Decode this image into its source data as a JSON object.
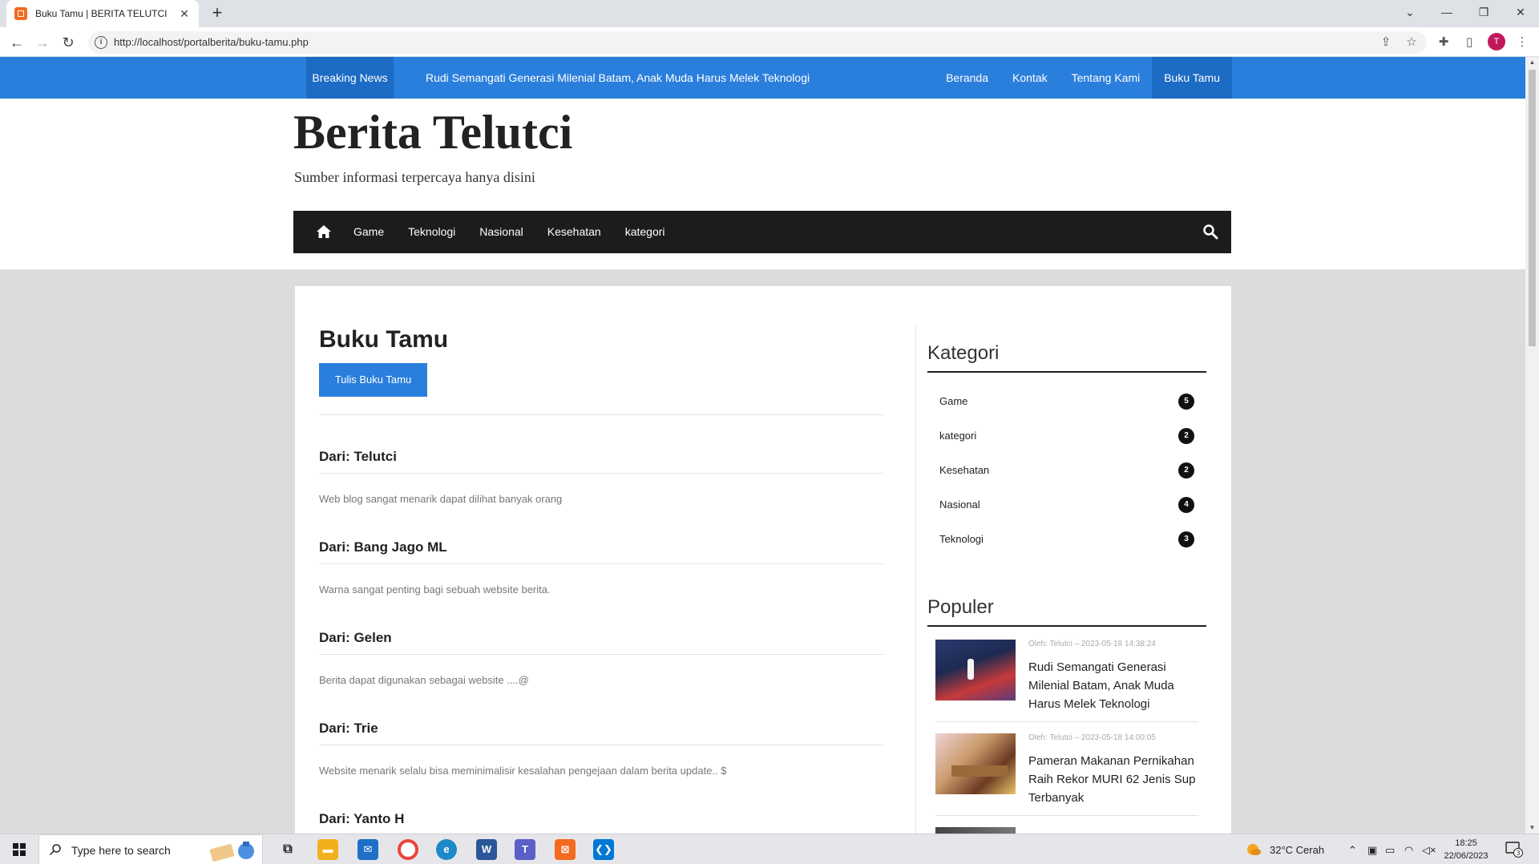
{
  "browser": {
    "tab_title": "Buku Tamu | BERITA TELUTCI",
    "url": "http://localhost/portalberita/buku-tamu.php",
    "profile_initial": "T"
  },
  "topbar": {
    "breaking_label": "Breaking News",
    "ticker": "Rudi Semangati Generasi Milenial Batam, Anak Muda Harus Melek Teknologi",
    "nav": [
      "Beranda",
      "Kontak",
      "Tentang Kami",
      "Buku Tamu"
    ],
    "active_nav": "Buku Tamu"
  },
  "header": {
    "site_title": "Berita Telutci",
    "tagline": "Sumber informasi terpercaya hanya disini"
  },
  "mainnav": {
    "items": [
      "Game",
      "Teknologi",
      "Nasional",
      "Kesehatan",
      "kategori"
    ]
  },
  "main": {
    "heading": "Buku Tamu",
    "write_button": "Tulis Buku Tamu",
    "entries": [
      {
        "from": "Dari: Telutci",
        "message": "Web blog sangat menarik dapat dilihat banyak orang"
      },
      {
        "from": "Dari: Bang Jago ML",
        "message": "Warna sangat penting bagi sebuah website berita."
      },
      {
        "from": "Dari: Gelen",
        "message": "Berita dapat digunakan sebagai website ....@"
      },
      {
        "from": "Dari: Trie",
        "message": "Website menarik selalu bisa meminimalisir kesalahan pengejaan dalam berita update.. $"
      },
      {
        "from": "Dari: Yanto H",
        "message": ""
      }
    ]
  },
  "sidebar": {
    "categories_title": "Kategori",
    "categories": [
      {
        "name": "Game",
        "count": "5"
      },
      {
        "name": "kategori",
        "count": "2"
      },
      {
        "name": "Kesehatan",
        "count": "2"
      },
      {
        "name": "Nasional",
        "count": "4"
      },
      {
        "name": "Teknologi",
        "count": "3"
      }
    ],
    "popular_title": "Populer",
    "popular": [
      {
        "meta": "Oleh: Telutci  –  2023-05-18 14:38:24",
        "title": "Rudi Semangati Generasi Milenial Batam, Anak Muda Harus Melek Teknologi"
      },
      {
        "meta": "Oleh: Telutci  –  2023-05-18 14:00:05",
        "title": "Pameran Makanan Pernikahan Raih Rekor MURI 62 Jenis Sup Terbanyak"
      }
    ]
  },
  "taskbar": {
    "search_placeholder": "Type here to search",
    "weather": "32°C  Cerah",
    "time": "18:25",
    "date": "22/06/2023",
    "notif_count": "3"
  },
  "colors": {
    "accent": "#2b7fdc",
    "accent_dark": "#1c6bc4",
    "nav_dark": "#1c1c1c"
  }
}
